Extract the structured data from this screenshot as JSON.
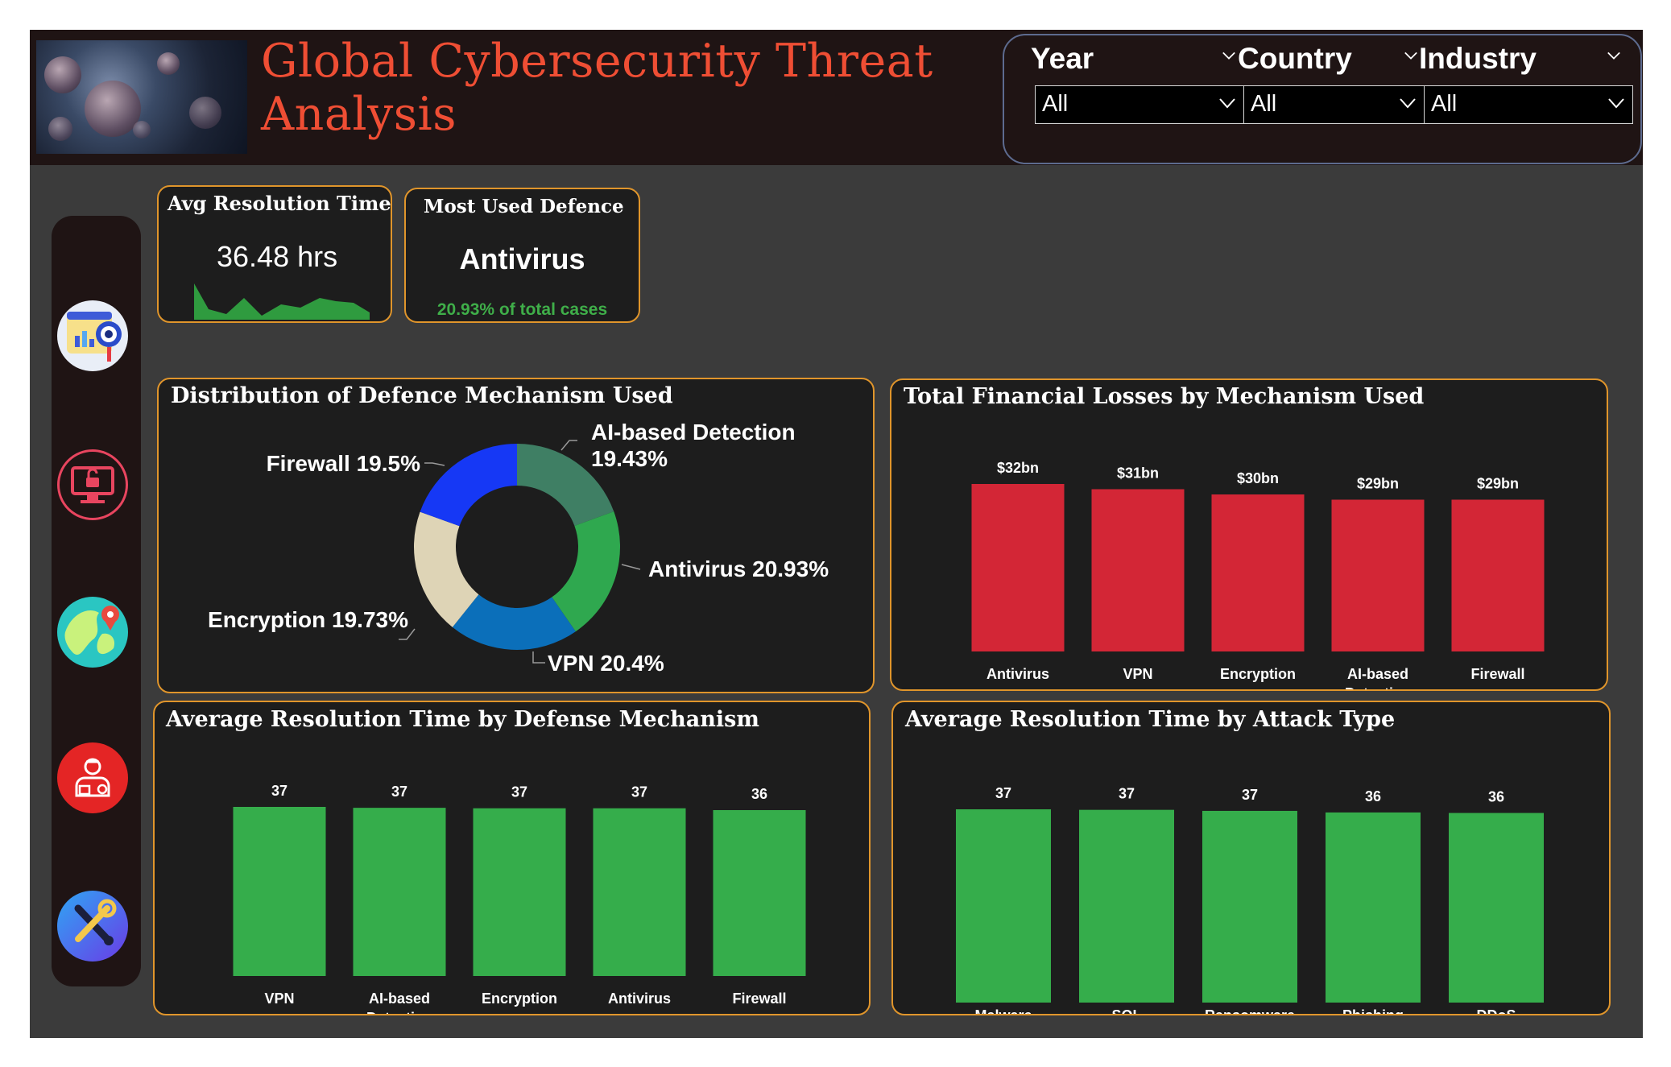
{
  "header": {
    "title_line1": "Global Cybersecurity Threat",
    "title_line2": "Analysis"
  },
  "filters": [
    {
      "label": "Year",
      "value": "All"
    },
    {
      "label": "Country",
      "value": "All"
    },
    {
      "label": "Industry",
      "value": "All"
    }
  ],
  "sidebar": {
    "icons": [
      "dashboard-eye-icon",
      "computer-unlock-icon",
      "world-map-pin-icon",
      "security-person-icon",
      "tools-icon"
    ]
  },
  "kpis": {
    "avg_resolution": {
      "title": "Avg Resolution Time",
      "value": "36.48 hrs"
    },
    "most_used": {
      "title": "Most Used Defence",
      "value": "Antivirus",
      "sub": "20.93% of total cases"
    }
  },
  "colors": {
    "accent_border": "#e0952b",
    "title_orange": "#ef4e34",
    "bar_red": "#d32636",
    "bar_green": "#35ad4b",
    "kpi_green": "#3fae49"
  },
  "chart_data": [
    {
      "type": "pie",
      "title": "Distribution of Defence Mechanism Used",
      "slices": [
        {
          "label": "AI-based Detection",
          "value": 19.43,
          "display": "19.43%",
          "color": "#3f7f64"
        },
        {
          "label": "Antivirus",
          "value": 20.93,
          "display": "Antivirus 20.93%",
          "color": "#2fa84f"
        },
        {
          "label": "VPN",
          "value": 20.4,
          "display": "VPN 20.4%",
          "color": "#0b6fba"
        },
        {
          "label": "Encryption",
          "value": 19.73,
          "display": "Encryption 19.73%",
          "color": "#ded4b6"
        },
        {
          "label": "Firewall",
          "value": 19.5,
          "display": "Firewall 19.5%",
          "color": "#1638f5"
        }
      ]
    },
    {
      "type": "bar",
      "title": "Total Financial Losses by Mechanism Used",
      "categories": [
        "Antivirus",
        "VPN",
        "Encryption",
        "AI-based Detection",
        "Firewall"
      ],
      "values": [
        32,
        31,
        30,
        29,
        29
      ],
      "value_labels": [
        "$32bn",
        "$31bn",
        "$30bn",
        "$29bn",
        "$29bn"
      ],
      "unit": "bn"
    },
    {
      "type": "bar",
      "title": "Average Resolution Time by Defense Mechanism",
      "categories": [
        "VPN",
        "AI-based Detection",
        "Encryption",
        "Antivirus",
        "Firewall"
      ],
      "values": [
        36.8,
        36.6,
        36.5,
        36.5,
        36.1
      ],
      "value_labels": [
        "37",
        "37",
        "37",
        "37",
        "36"
      ]
    },
    {
      "type": "bar",
      "title": "Average Resolution Time by Attack Type",
      "categories": [
        "Malware",
        "SQL Injection",
        "Ransomware",
        "Phishing",
        "DDoS"
      ],
      "values": [
        36.9,
        36.8,
        36.6,
        36.3,
        36.2
      ],
      "value_labels": [
        "37",
        "37",
        "37",
        "36",
        "36"
      ]
    }
  ]
}
